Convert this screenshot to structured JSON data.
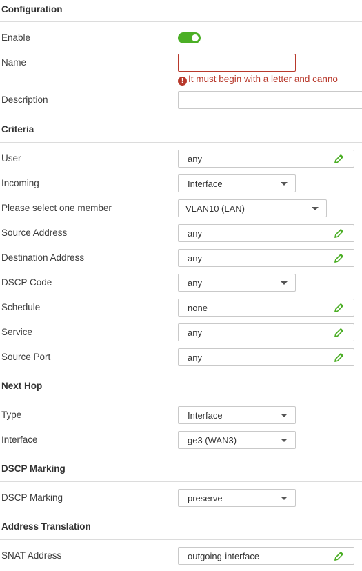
{
  "configuration": {
    "title": "Configuration",
    "enable_label": "Enable",
    "enable_on": true,
    "name_label": "Name",
    "name_value": "",
    "name_error": "It must begin with a letter and canno",
    "description_label": "Description",
    "description_value": ""
  },
  "criteria": {
    "title": "Criteria",
    "user_label": "User",
    "user_value": "any",
    "incoming_label": "Incoming",
    "incoming_value": "Interface",
    "member_label": "Please select one member",
    "member_value": "VLAN10 (LAN)",
    "source_address_label": "Source Address",
    "source_address_value": "any",
    "destination_address_label": "Destination Address",
    "destination_address_value": "any",
    "dscp_code_label": "DSCP Code",
    "dscp_code_value": "any",
    "schedule_label": "Schedule",
    "schedule_value": "none",
    "service_label": "Service",
    "service_value": "any",
    "source_port_label": "Source Port",
    "source_port_value": "any"
  },
  "next_hop": {
    "title": "Next Hop",
    "type_label": "Type",
    "type_value": "Interface",
    "interface_label": "Interface",
    "interface_value": "ge3 (WAN3)"
  },
  "dscp_marking": {
    "title": "DSCP Marking",
    "marking_label": "DSCP Marking",
    "marking_value": "preserve"
  },
  "address_translation": {
    "title": "Address Translation",
    "snat_label": "SNAT Address",
    "snat_value": "outgoing-interface"
  },
  "colors": {
    "accent_green": "#4caf26",
    "error_red": "#b8392c"
  }
}
